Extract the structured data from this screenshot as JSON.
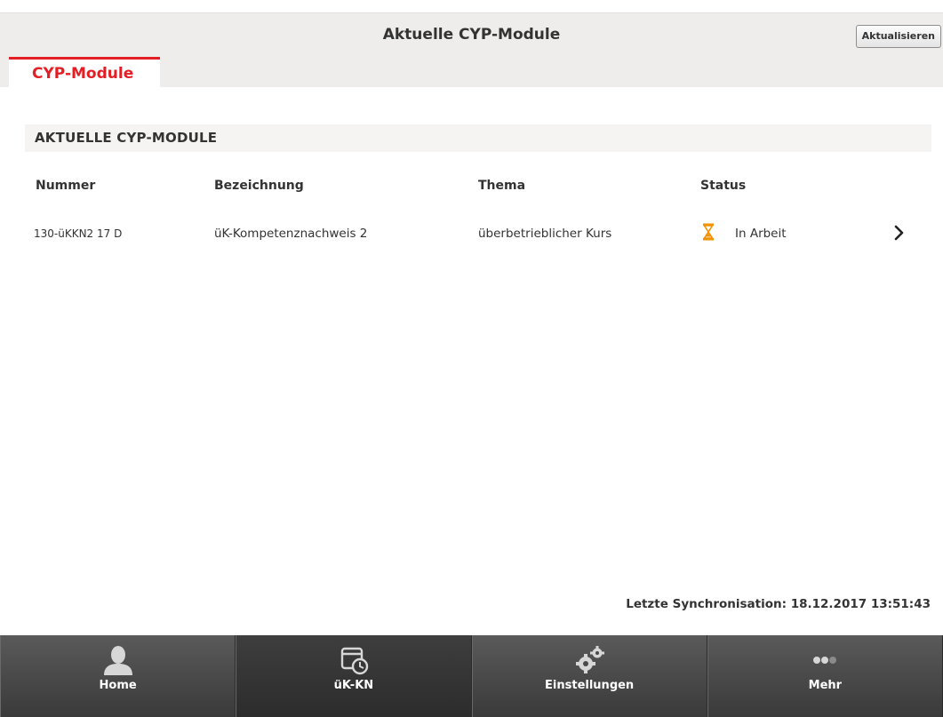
{
  "header": {
    "title": "Aktuelle CYP-Module",
    "refresh_label": "Aktualisieren"
  },
  "tabs": [
    {
      "label": "CYP-Module",
      "active": true
    }
  ],
  "section": {
    "title": "AKTUELLE CYP-MODULE"
  },
  "table": {
    "columns": [
      "Nummer",
      "Bezeichnung",
      "Thema",
      "Status"
    ],
    "rows": [
      {
        "nummer": "130-üKKN2 17 D",
        "bezeichnung": "üK-Kompetenznachweis 2",
        "thema": "überbetrieblicher Kurs",
        "status": "In Arbeit",
        "status_icon": "hourglass-icon"
      }
    ]
  },
  "footer": {
    "sync_text": "Letzte Synchronisation: 18.12.2017 13:51:43"
  },
  "nav": [
    {
      "label": "Home",
      "icon": "person-icon",
      "active": false
    },
    {
      "label": "üK-KN",
      "icon": "calendar-clock-icon",
      "active": true
    },
    {
      "label": "Einstellungen",
      "icon": "gears-icon",
      "active": false
    },
    {
      "label": "Mehr",
      "icon": "more-dots-icon",
      "active": false
    }
  ],
  "colors": {
    "accent": "#e31e24",
    "status_icon": "#f39200",
    "header_bg": "#efedeb",
    "navbar_bg": "#4a4a4a"
  }
}
